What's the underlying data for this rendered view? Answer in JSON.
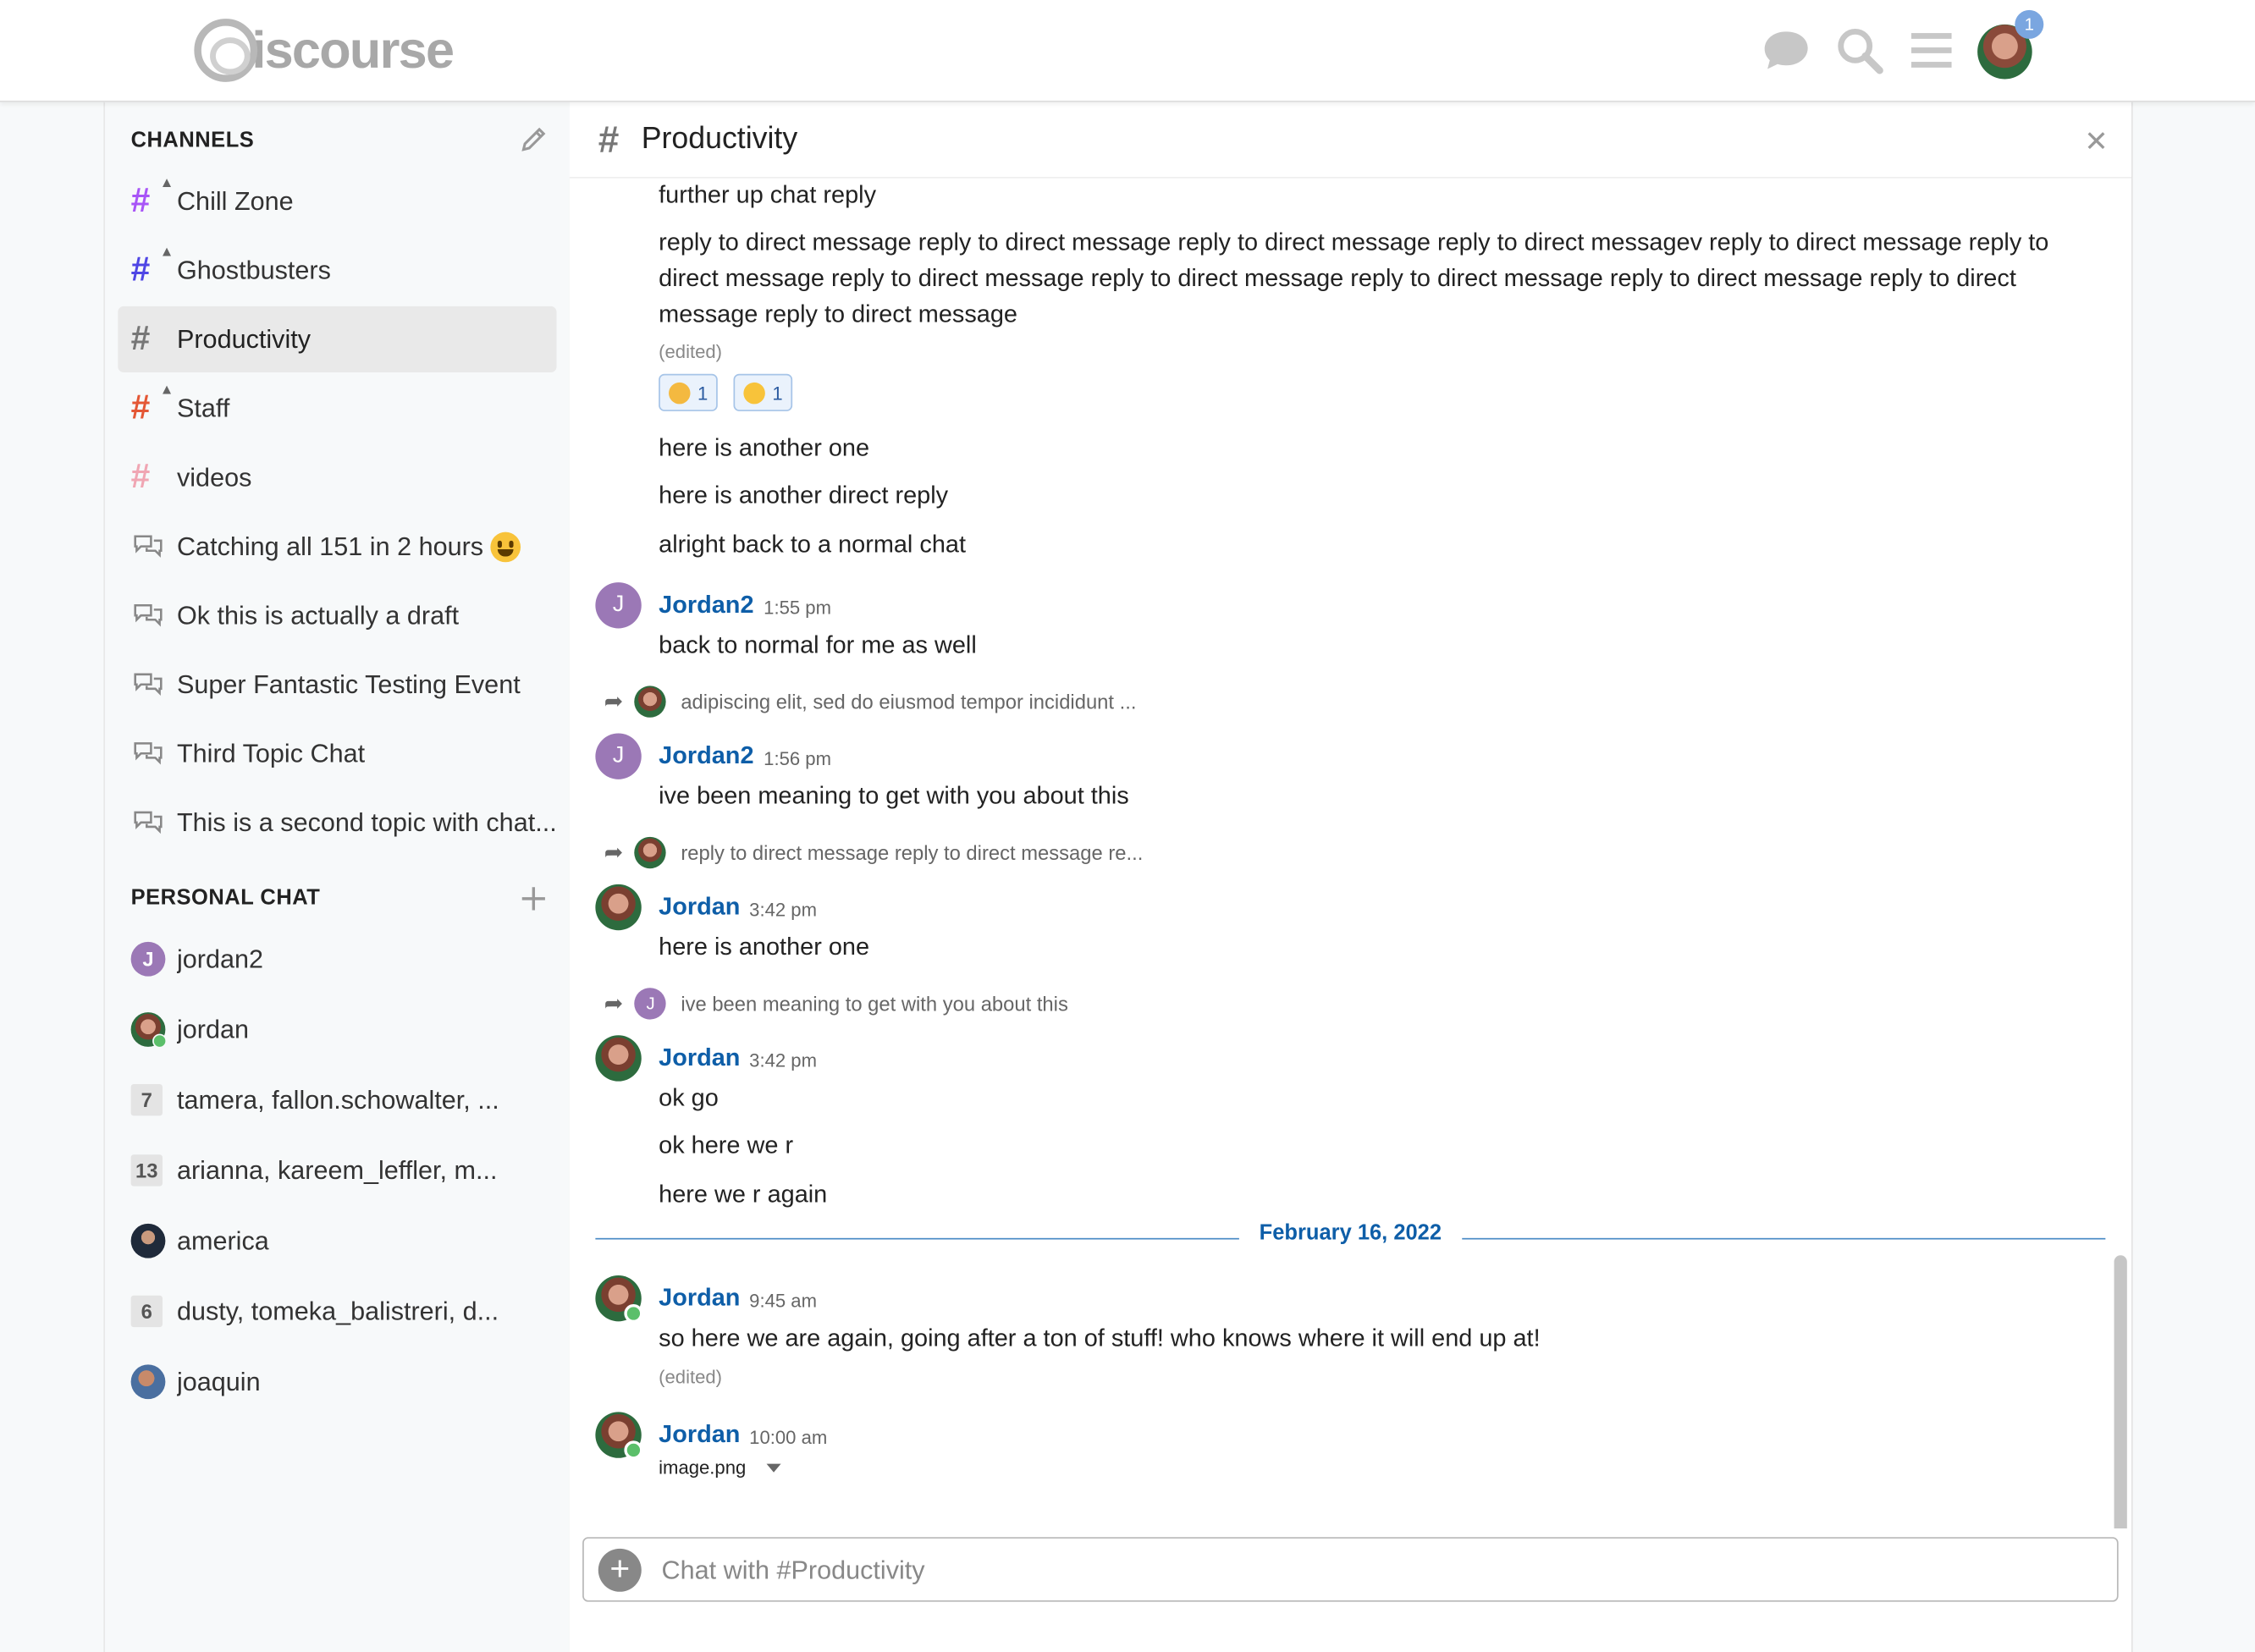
{
  "header": {
    "logo_text": "iscourse",
    "notification_count": "1"
  },
  "sidebar": {
    "channels_title": "CHANNELS",
    "personal_title": "PERSONAL CHAT",
    "channels": [
      {
        "label": "Chill Zone",
        "color": "#a855f7",
        "locked": true
      },
      {
        "label": "Ghostbusters",
        "color": "#4f46e5",
        "locked": true
      },
      {
        "label": "Productivity",
        "color": "#777777",
        "locked": false,
        "active": true
      },
      {
        "label": "Staff",
        "color": "#e45735",
        "locked": true
      },
      {
        "label": "videos",
        "color": "#f0a6b3",
        "locked": false
      },
      {
        "label": "Catching all 151 in 2 hours",
        "icon": "chat-bubbles-icon"
      },
      {
        "label": "Ok this is actually a draft",
        "icon": "chat-bubbles-icon"
      },
      {
        "label": "Super Fantastic Testing Event",
        "icon": "chat-bubbles-icon"
      },
      {
        "label": "Third Topic Chat",
        "icon": "chat-bubbles-icon"
      },
      {
        "label": "This is a second topic with chat...",
        "icon": "chat-bubbles-icon"
      }
    ],
    "personal": [
      {
        "label": "jordan2",
        "avatar_letter": "J"
      },
      {
        "label": "jordan"
      },
      {
        "label": "tamera, fallon.schowalter, ...",
        "count": "7"
      },
      {
        "label": "arianna, kareem_leffler, m...",
        "count": "13"
      },
      {
        "label": "america"
      },
      {
        "label": "dusty, tomeka_balistreri, d...",
        "count": "6"
      },
      {
        "label": "joaquin"
      }
    ]
  },
  "channel": {
    "title": "Productivity"
  },
  "messages": {
    "m1": "further up chat reply",
    "m2": "reply to direct message reply to direct message reply to direct message reply to direct messagev reply to direct message reply to direct message reply to direct message reply to direct message reply to direct message reply to direct message reply to direct message reply to direct message",
    "edited": "(edited)",
    "reaction1_count": "1",
    "reaction2_count": "1",
    "m3": "here is another one",
    "m4": "here is another direct reply",
    "m5": "alright back to a normal chat",
    "g1_user": "Jordan2",
    "g1_time": "1:55 pm",
    "g1_avatar": "J",
    "g1_text": "back to normal for me as well",
    "r1_text": "adipiscing elit, sed do eiusmod tempor incididunt ...",
    "g2_user": "Jordan2",
    "g2_time": "1:56 pm",
    "g2_avatar": "J",
    "g2_text": "ive been meaning to get with you about this",
    "r2_text": "reply to direct message reply to direct message re...",
    "g3_user": "Jordan",
    "g3_time": "3:42 pm",
    "g3_text": "here is another one",
    "r3_avatar": "J",
    "r3_text": "ive been meaning to get with you about this",
    "g4_user": "Jordan",
    "g4_time": "3:42 pm",
    "g4_text1": "ok go",
    "g4_text2": "ok here we r",
    "g4_text3": "here we r again",
    "date_separator": "February 16, 2022",
    "g5_user": "Jordan",
    "g5_time": "9:45 am",
    "g5_text": "so here we are again, going after a ton of stuff! who knows where it will end up at!",
    "g5_edited": "(edited)",
    "g6_user": "Jordan",
    "g6_time": "10:00 am",
    "g6_file": "image.png"
  },
  "composer": {
    "placeholder": "Chat with #Productivity"
  }
}
